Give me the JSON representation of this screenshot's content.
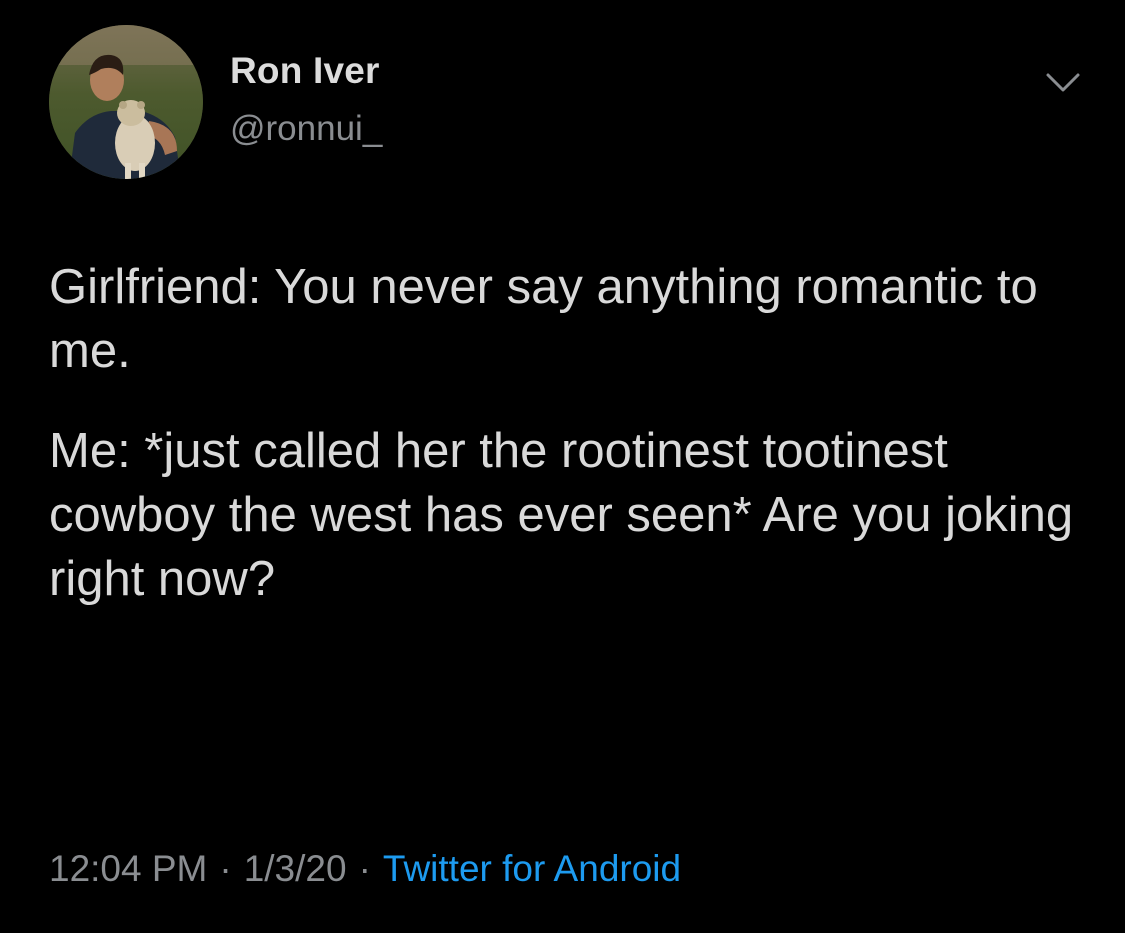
{
  "user": {
    "display_name": "Ron Iver",
    "handle": "@ronnui_",
    "avatar_icon": "profile-photo"
  },
  "menu": {
    "icon": "chevron-down-icon"
  },
  "tweet": {
    "paragraphs": [
      "Girlfriend: You never say anything romantic to me.",
      "Me: *just called her the rootinest tootinest cowboy the west has ever seen* Are you joking right now?"
    ]
  },
  "meta": {
    "time": "12:04 PM",
    "separator": "·",
    "date": "1/3/20",
    "source": "Twitter for Android"
  },
  "colors": {
    "background": "#000000",
    "text": "#d9d9d9",
    "secondary": "#8a8d91",
    "link": "#1d9bf0"
  }
}
